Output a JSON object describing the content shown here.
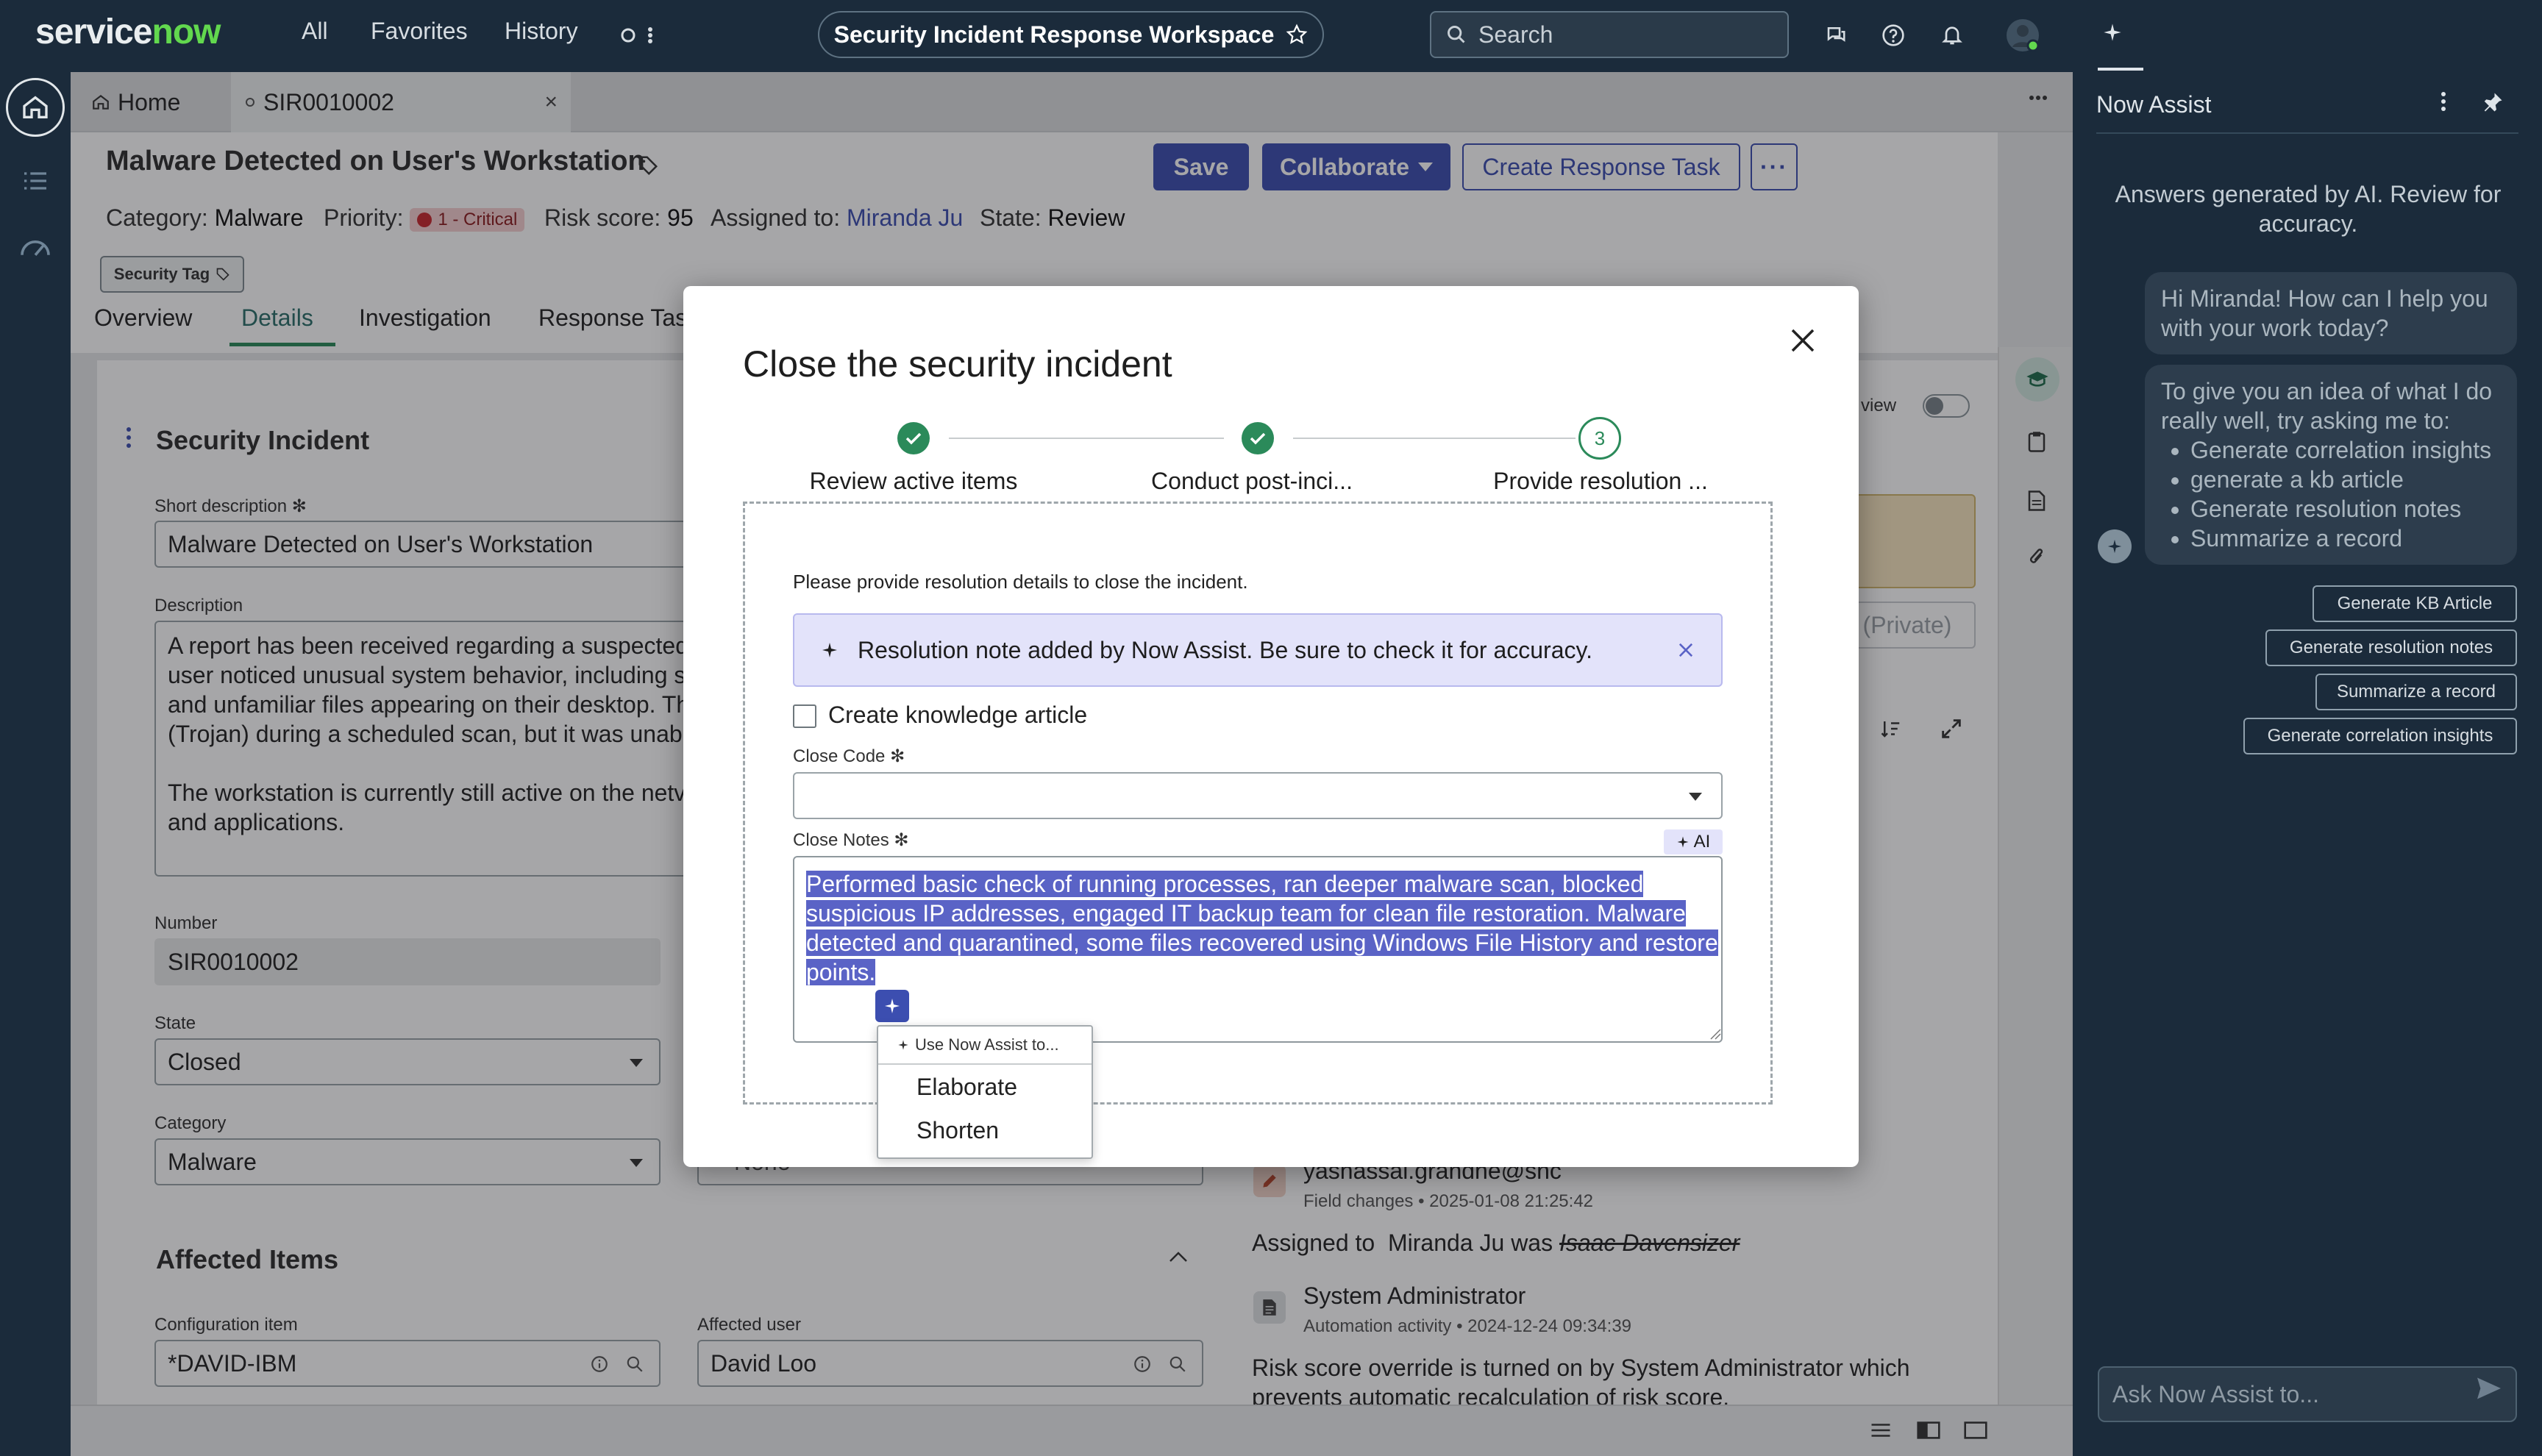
{
  "topbar": {
    "brand": "servicenow",
    "nav": [
      "All",
      "Favorites",
      "History"
    ],
    "workspace_title": "Security Incident Response Workspace",
    "search_placeholder": "Search"
  },
  "tabs": [
    {
      "label": "Home"
    },
    {
      "label": "SIR0010002",
      "close": "×"
    }
  ],
  "record": {
    "title": "Malware Detected on User's Workstation",
    "category_label": "Category:",
    "category": "Malware",
    "priority_label": "Priority:",
    "priority": "1 - Critical",
    "risk_label": "Risk score:",
    "risk": "95",
    "assigned_label": "Assigned to:",
    "assigned": "Miranda Ju",
    "state_label": "State:",
    "state": "Review",
    "tag": "Security Tag",
    "save": "Save",
    "collaborate": "Collaborate",
    "create_task": "Create Response Task",
    "more": "···"
  },
  "section_tabs": [
    "Overview",
    "Details",
    "Investigation",
    "Response Task"
  ],
  "form": {
    "section_title": "Security Incident",
    "short_desc_label": "Short description",
    "short_desc": "Malware Detected on User's Workstation",
    "description_label": "Description",
    "description_lines": [
      "A report has been received regarding a suspected",
      "user noticed unusual system behavior, including sl",
      "and unfamiliar files appearing on their desktop. Th",
      "(Trojan) during a scheduled scan, but it was unable",
      "",
      "The workstation is currently still active on the netv",
      "and applications."
    ],
    "number_label": "Number",
    "number": "SIR0010002",
    "state_label": "State",
    "state": "Closed",
    "category_label": "Category",
    "category": "Malware",
    "hidden_field_value": "None",
    "affected_title": "Affected Items",
    "ci_label": "Configuration item",
    "ci": "*DAVID-IBM",
    "user_label": "Affected user",
    "user": "David Loo"
  },
  "right_panel": {
    "compact_view": "d view",
    "private_button": "(Private)"
  },
  "activity": [
    {
      "author": "yashassai.grandhe@snc",
      "meta": "Field changes • 2025-01-08 21:25:42",
      "body_prefix": "Assigned to",
      "body_new": "Miranda Ju was",
      "body_old": "Isaac Davensizer"
    },
    {
      "author": "System Administrator",
      "meta": "Automation activity • 2024-12-24 09:34:39",
      "body_line1": "Risk score override is turned on by System Administrator which",
      "body_line2": "prevents automatic recalculation of risk score."
    }
  ],
  "modal": {
    "title": "Close the security incident",
    "steps": [
      {
        "label": "Review active items",
        "status": "done"
      },
      {
        "label": "Conduct post-inci...",
        "status": "done"
      },
      {
        "label": "Provide resolution ...",
        "status": "current",
        "number": "3"
      }
    ],
    "instruction": "Please provide resolution details to close the incident.",
    "banner": "Resolution note added by Now Assist. Be sure to check it for accuracy.",
    "kb_checkbox": "Create knowledge article",
    "close_code_label": "Close Code",
    "close_code_value": "",
    "close_notes_label": "Close Notes",
    "ai_chip": "AI",
    "close_notes_lines": [
      "Performed basic check of running processes, ran deeper malware scan, blocked",
      "suspicious IP addresses, engaged IT backup team for clean file restoration. Malware",
      "detected and quarantined, some files recovered using Windows File History and restore",
      "points."
    ],
    "menu_header": "Use Now Assist to...",
    "menu_items": [
      "Elaborate",
      "Shorten"
    ]
  },
  "assist": {
    "title": "Now Assist",
    "disclaimer": "Answers generated by AI. Review for accuracy.",
    "greeting": "Hi Miranda! How can I help you with your work today?",
    "intro": "To give you an idea of what I do really well, try asking me to:",
    "bullets": [
      "Generate correlation insights",
      "generate a kb article",
      "Generate resolution notes",
      "Summarize a record"
    ],
    "suggestions": [
      "Generate KB Article",
      "Generate resolution notes",
      "Summarize a record",
      "Generate correlation insights"
    ],
    "ask_placeholder": "Ask Now Assist to..."
  },
  "colors": {
    "brand_green": "#62d84e",
    "primary": "#3c4eb0",
    "success": "#2b8a5a",
    "highlight": "#5a63c6",
    "critical": "#c8282e"
  }
}
